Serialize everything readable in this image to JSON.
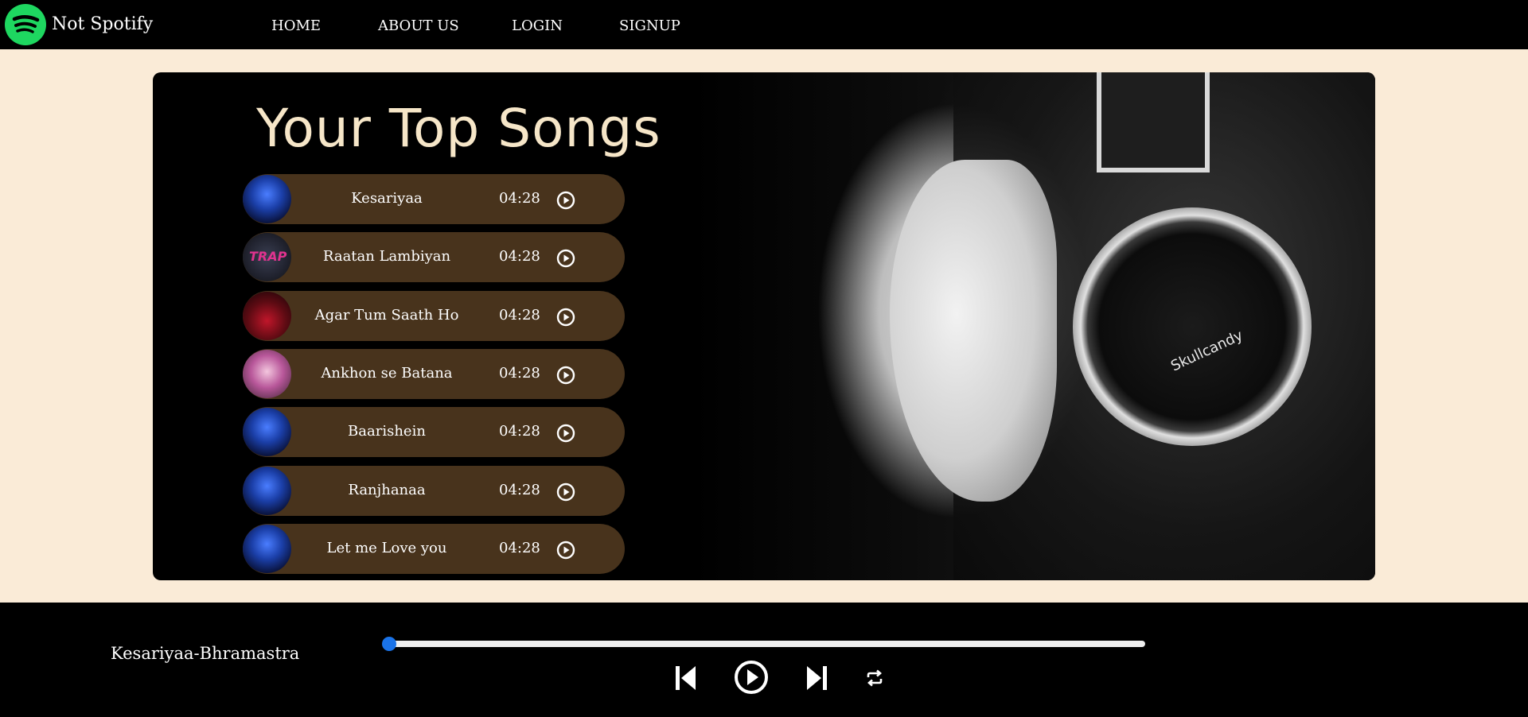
{
  "brand": {
    "name": "Not Spotify",
    "icon": "spotify-logo-icon",
    "color": "#1ed760"
  },
  "nav": {
    "links": [
      {
        "label": "HOME"
      },
      {
        "label": "ABOUT US"
      },
      {
        "label": "LOGIN"
      },
      {
        "label": "SIGNUP"
      }
    ]
  },
  "main": {
    "title": "Your Top Songs",
    "row_color": "#48331c",
    "songs": [
      {
        "name": "Kesariyaa",
        "duration": "04:28",
        "cover": "blue"
      },
      {
        "name": "Raatan Lambiyan",
        "duration": "04:28",
        "cover": "trap"
      },
      {
        "name": "Agar Tum Saath Ho",
        "duration": "04:28",
        "cover": "red"
      },
      {
        "name": "Ankhon se Batana",
        "duration": "04:28",
        "cover": "pink"
      },
      {
        "name": "Baarishein",
        "duration": "04:28",
        "cover": "blue"
      },
      {
        "name": "Ranjhanaa",
        "duration": "04:28",
        "cover": "blue"
      },
      {
        "name": "Let me Love you",
        "duration": "04:28",
        "cover": "blue"
      }
    ],
    "hero_image": {
      "brand_text": "Skullcandy"
    }
  },
  "player": {
    "now_playing": "Kesariyaa-Bhramastra",
    "progress": 0.0,
    "accent": "#1a73e8",
    "controls": [
      "previous-icon",
      "play-icon",
      "next-icon",
      "repeat-icon"
    ]
  }
}
